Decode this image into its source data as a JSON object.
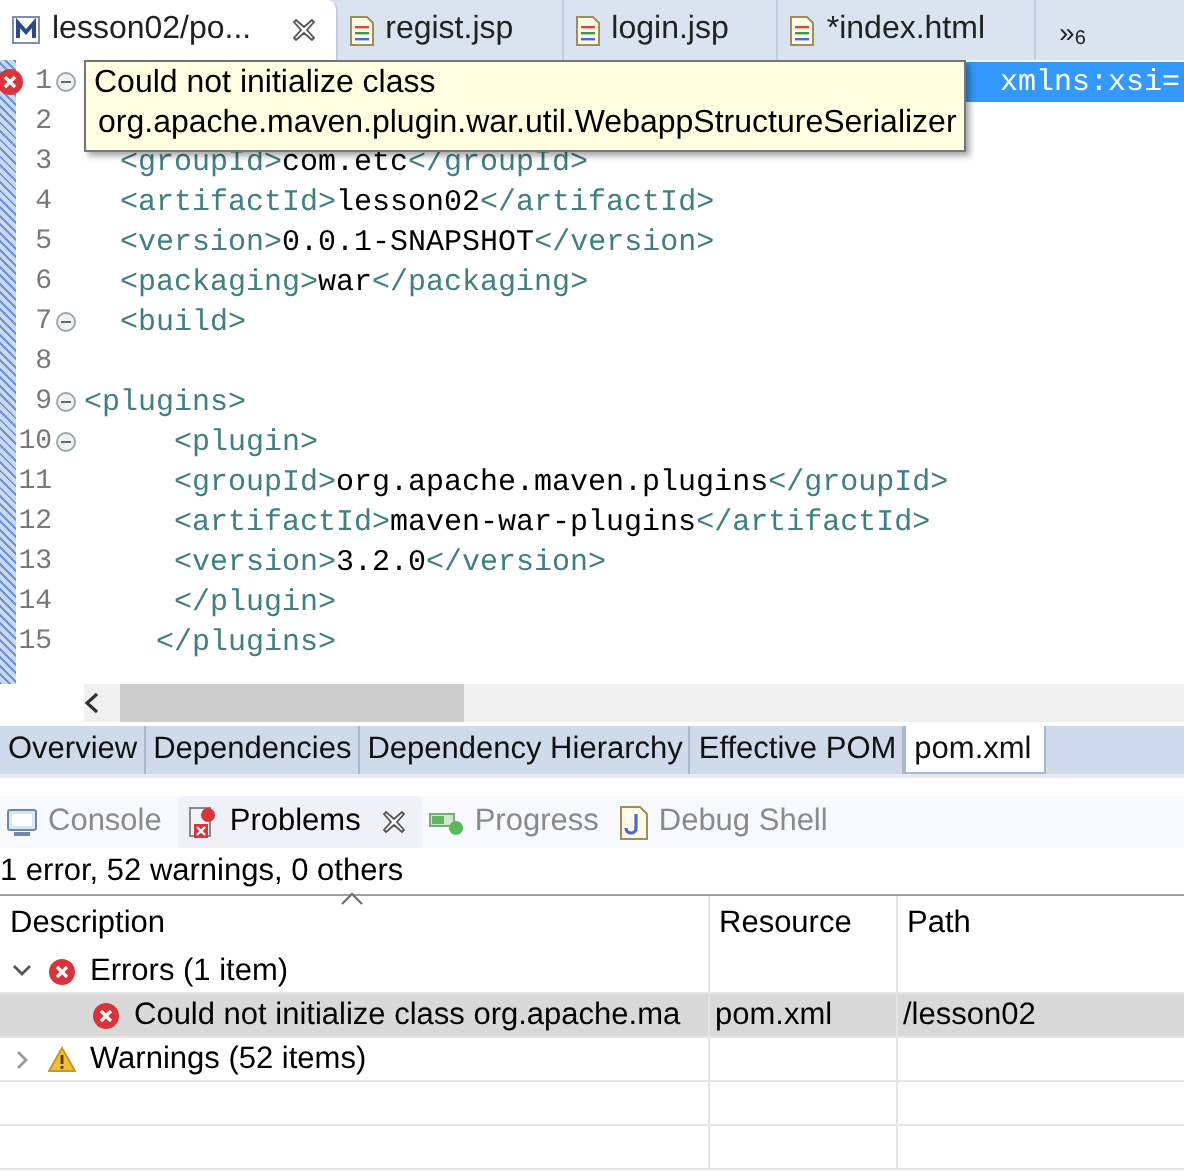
{
  "editor_tabs": [
    {
      "label": "lesson02/po...",
      "kind": "maven",
      "selected": true,
      "closable": true
    },
    {
      "label": "regist.jsp",
      "kind": "file",
      "selected": false,
      "closable": false
    },
    {
      "label": "login.jsp",
      "kind": "file",
      "selected": false,
      "closable": false
    },
    {
      "label": "*index.html",
      "kind": "file",
      "selected": false,
      "closable": false
    }
  ],
  "overflow": {
    "label": "»",
    "count": "6"
  },
  "editor": {
    "lines": [
      {
        "number": "1",
        "folding": true,
        "error": true,
        "parts": [
          {
            "kind": "selected",
            "text": "xmlns:xsi="
          }
        ]
      },
      {
        "number": "2",
        "folding": false,
        "error": false
      },
      {
        "number": "3",
        "folding": false,
        "error": false,
        "parts": [
          {
            "kind": "tag",
            "text": "  <groupId>"
          },
          {
            "kind": "text",
            "text": "com.etc"
          },
          {
            "kind": "tag",
            "text": "</groupId>"
          }
        ]
      },
      {
        "number": "4",
        "folding": false,
        "error": false,
        "parts": [
          {
            "kind": "tag",
            "text": "  <artifactId>"
          },
          {
            "kind": "text",
            "text": "lesson02"
          },
          {
            "kind": "tag",
            "text": "</artifactId>"
          }
        ]
      },
      {
        "number": "5",
        "folding": false,
        "error": false,
        "parts": [
          {
            "kind": "tag",
            "text": "  <version>"
          },
          {
            "kind": "text",
            "text": "0.0.1-SNAPSHOT"
          },
          {
            "kind": "tag",
            "text": "</version>"
          }
        ]
      },
      {
        "number": "6",
        "folding": false,
        "error": false,
        "parts": [
          {
            "kind": "tag",
            "text": "  <packaging>"
          },
          {
            "kind": "text",
            "text": "war"
          },
          {
            "kind": "tag",
            "text": "</packaging>"
          }
        ]
      },
      {
        "number": "7",
        "folding": true,
        "error": false,
        "parts": [
          {
            "kind": "tag",
            "text": "  <build>"
          }
        ]
      },
      {
        "number": "8",
        "folding": false,
        "error": false
      },
      {
        "number": "9",
        "folding": true,
        "error": false,
        "parts": [
          {
            "kind": "tag",
            "text": "<plugins>"
          }
        ]
      },
      {
        "number": "10",
        "folding": true,
        "error": false,
        "parts": [
          {
            "kind": "tag",
            "text": "     <plugin>"
          }
        ]
      },
      {
        "number": "11",
        "folding": false,
        "error": false,
        "parts": [
          {
            "kind": "tag",
            "text": "     <groupId>"
          },
          {
            "kind": "text",
            "text": "org.apache.maven.plugins"
          },
          {
            "kind": "tag",
            "text": "</groupId>"
          }
        ]
      },
      {
        "number": "12",
        "folding": false,
        "error": false,
        "parts": [
          {
            "kind": "tag",
            "text": "     <artifactId>"
          },
          {
            "kind": "text",
            "text": "maven-war-plugins"
          },
          {
            "kind": "tag",
            "text": "</artifactId>"
          }
        ]
      },
      {
        "number": "13",
        "folding": false,
        "error": false,
        "parts": [
          {
            "kind": "tag",
            "text": "     <version>"
          },
          {
            "kind": "text",
            "text": "3.2.0"
          },
          {
            "kind": "tag",
            "text": "</version>"
          }
        ]
      },
      {
        "number": "14",
        "folding": false,
        "error": false,
        "parts": [
          {
            "kind": "tag",
            "text": "     </plugin>"
          }
        ]
      },
      {
        "number": "15",
        "folding": false,
        "error": false,
        "parts": [
          {
            "kind": "tag",
            "text": "    </plugins>"
          }
        ]
      }
    ]
  },
  "tooltip": {
    "lines": [
      "Could not initialize class",
      "org.apache.maven.plugin.war.util.WebappStructureSerializer"
    ]
  },
  "page_tabs": [
    {
      "label": "Overview",
      "selected": false
    },
    {
      "label": "Dependencies",
      "selected": false
    },
    {
      "label": "Dependency Hierarchy",
      "selected": false
    },
    {
      "label": "Effective POM",
      "selected": false
    },
    {
      "label": "pom.xml",
      "selected": true
    }
  ],
  "view_tabs": [
    {
      "label": "Console",
      "kind": "console",
      "selected": false,
      "closable": false
    },
    {
      "label": "Problems",
      "kind": "problems",
      "selected": true,
      "closable": true
    },
    {
      "label": "Progress",
      "kind": "progress",
      "selected": false,
      "closable": false
    },
    {
      "label": "Debug Shell",
      "kind": "shell",
      "selected": false,
      "closable": false
    }
  ],
  "problems": {
    "summary": "1 error, 52 warnings, 0 others",
    "columns": [
      "Description",
      "Resource",
      "Path"
    ],
    "rows": [
      {
        "kind": "error-group",
        "description": "Errors (1 item)",
        "expanded": true,
        "selected": false,
        "children": [
          {
            "kind": "error",
            "description": "Could not initialize class org.apache.ma",
            "resource": "pom.xml",
            "path": "/lesson02",
            "selected": true
          }
        ]
      },
      {
        "kind": "warning-group",
        "description": "Warnings (52 items)",
        "expanded": false,
        "selected": false
      }
    ]
  }
}
